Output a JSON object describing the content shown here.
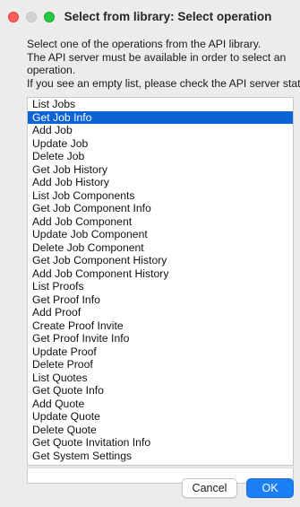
{
  "window": {
    "title": "Select from library: Select operation"
  },
  "message": {
    "lines": [
      "Select one of the operations from the API library.",
      "The API server must be available in order to select an",
      "operation.",
      "If you see an empty list, please check the API server status."
    ]
  },
  "list": {
    "selected_index": 1,
    "items": [
      "List Jobs",
      "Get Job Info",
      "Add Job",
      "Update Job",
      "Delete Job",
      "Get Job History",
      "Add Job History",
      "List Job Components",
      "Get Job Component Info",
      "Add Job Component",
      "Update Job Component",
      "Delete Job Component",
      "Get Job Component History",
      "Add Job Component History",
      "List Proofs",
      "Get Proof Info",
      "Add Proof",
      "Create Proof Invite",
      "Get Proof Invite Info",
      "Update Proof",
      "Delete Proof",
      "List Quotes",
      "Get Quote Info",
      "Add Quote",
      "Update Quote",
      "Delete Quote",
      "Get Quote Invitation Info",
      "Get System Settings"
    ]
  },
  "buttons": {
    "cancel_label": "Cancel",
    "ok_label": "OK"
  },
  "colors": {
    "selection": "#0b63d6",
    "ok_button": "#1a7ef5",
    "close_light": "#fe5f57",
    "zoom_light": "#28c840"
  }
}
